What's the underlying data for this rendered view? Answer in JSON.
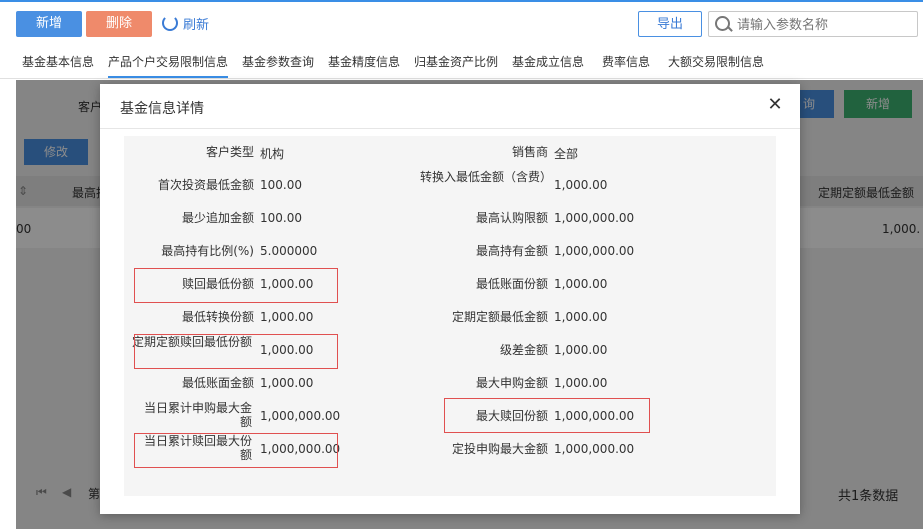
{
  "toolbar": {
    "add_label": "新增",
    "delete_label": "删除",
    "refresh_label": "刷新",
    "export_label": "导出"
  },
  "search": {
    "placeholder": "请输入参数名称"
  },
  "tabs": [
    "基金基本信息",
    "产品个户交易限制信息",
    "基金参数查询",
    "基金精度信息",
    "归基金资产比例",
    "基金成立信息",
    "费率信息",
    "大额交易限制信息"
  ],
  "background": {
    "client_label": "客户",
    "edit_label": "修改",
    "query_label": "询",
    "add_label": "新增",
    "col_max": "最高持",
    "col_fixed": "定期定额最低金额",
    "row_left": "00",
    "row_right": "1,000.",
    "pager_text": "第",
    "total_text": "共1条数据"
  },
  "modal": {
    "title": "基金信息详情",
    "left": [
      {
        "label": "客户类型",
        "value": "机构"
      },
      {
        "label": "首次投资最低金额",
        "value": "100.00"
      },
      {
        "label": "最少追加金额",
        "value": "100.00"
      },
      {
        "label": "最高持有比例(%)",
        "value": "5.000000"
      },
      {
        "label": "赎回最低份额",
        "value": "1,000.00"
      },
      {
        "label": "最低转换份额",
        "value": "1,000.00"
      },
      {
        "label": "定期定额赎回最低份额",
        "value": "1,000.00"
      },
      {
        "label": "最低账面金额",
        "value": "1,000.00"
      },
      {
        "label": "当日累计申购最大金额",
        "value": "1,000,000.00"
      },
      {
        "label": "当日累计赎回最大份额",
        "value": "1,000,000.00"
      }
    ],
    "right": [
      {
        "label": "销售商",
        "value": "全部"
      },
      {
        "label": "转换入最低金额（含费）",
        "value": "1,000.00"
      },
      {
        "label": "最高认购限额",
        "value": "1,000,000.00"
      },
      {
        "label": "最高持有金额",
        "value": "1,000,000.00"
      },
      {
        "label": "最低账面份额",
        "value": "1,000.00"
      },
      {
        "label": "定期定额最低金额",
        "value": "1,000.00"
      },
      {
        "label": "级差金额",
        "value": "1,000.00"
      },
      {
        "label": "最大申购金额",
        "value": "1,000.00"
      },
      {
        "label": "最大赎回份额",
        "value": "1,000,000.00"
      },
      {
        "label": "定投申购最大金额",
        "value": "1,000,000.00"
      }
    ]
  },
  "colors": {
    "primary": "#4a90e2",
    "danger": "#ef8a6b",
    "highlight": "#e05050",
    "success": "#3cb371"
  }
}
